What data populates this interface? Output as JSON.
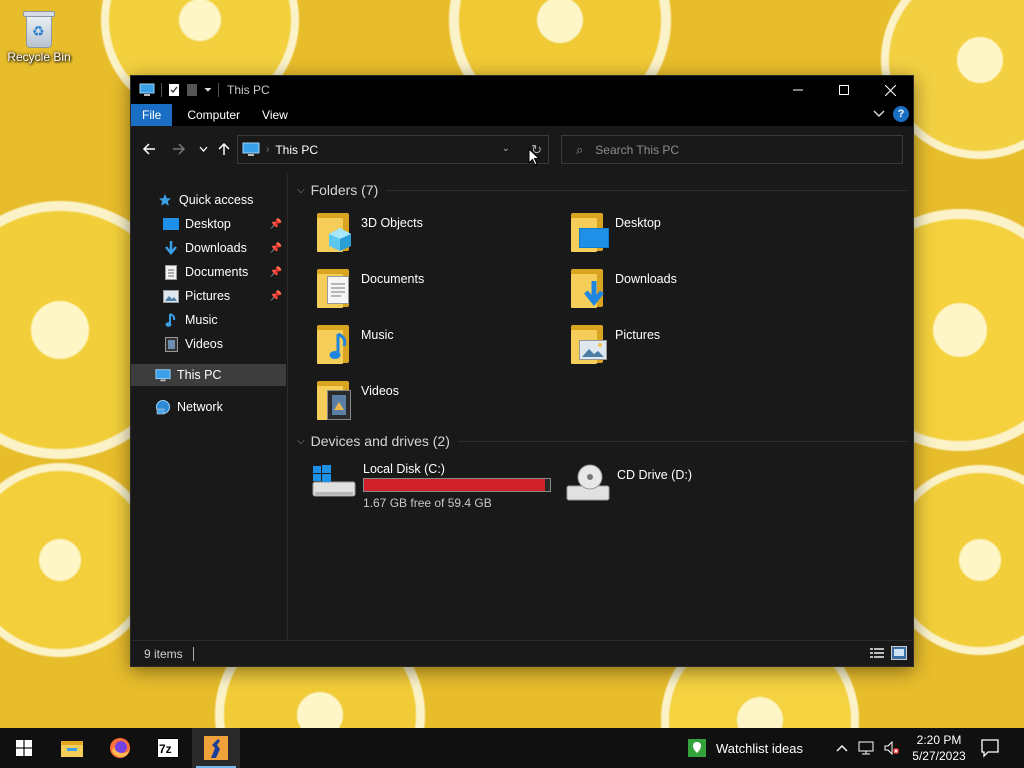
{
  "desktop": {
    "recycle_bin_label": "Recycle Bin"
  },
  "window": {
    "title": "This PC",
    "ribbon_tabs": [
      "File",
      "Computer",
      "View"
    ],
    "address": {
      "current": "This PC"
    },
    "search": {
      "placeholder": "Search This PC"
    },
    "sidebar": {
      "quick_access": "Quick access",
      "quick_items": [
        {
          "label": "Desktop",
          "pinned": true
        },
        {
          "label": "Downloads",
          "pinned": true
        },
        {
          "label": "Documents",
          "pinned": true
        },
        {
          "label": "Pictures",
          "pinned": true
        },
        {
          "label": "Music",
          "pinned": false
        },
        {
          "label": "Videos",
          "pinned": false
        }
      ],
      "this_pc": "This PC",
      "network": "Network"
    },
    "folders_group": "Folders (7)",
    "folders": [
      "3D Objects",
      "Desktop",
      "Documents",
      "Downloads",
      "Music",
      "Pictures",
      "Videos"
    ],
    "devices_group": "Devices and drives (2)",
    "drives": [
      {
        "label": "Local Disk (C:)",
        "free_text": "1.67 GB free of 59.4 GB",
        "used_fraction": 0.972
      },
      {
        "label": "CD Drive (D:)"
      }
    ],
    "status": {
      "items": "9 items"
    }
  },
  "taskbar": {
    "watchlist": "Watchlist ideas",
    "clock_time": "2:20 PM",
    "clock_date": "5/27/2023"
  },
  "colors": {
    "accent": "#1a6fc4",
    "drive_bar": "#d0202a",
    "folder": "#f5ce5a"
  }
}
